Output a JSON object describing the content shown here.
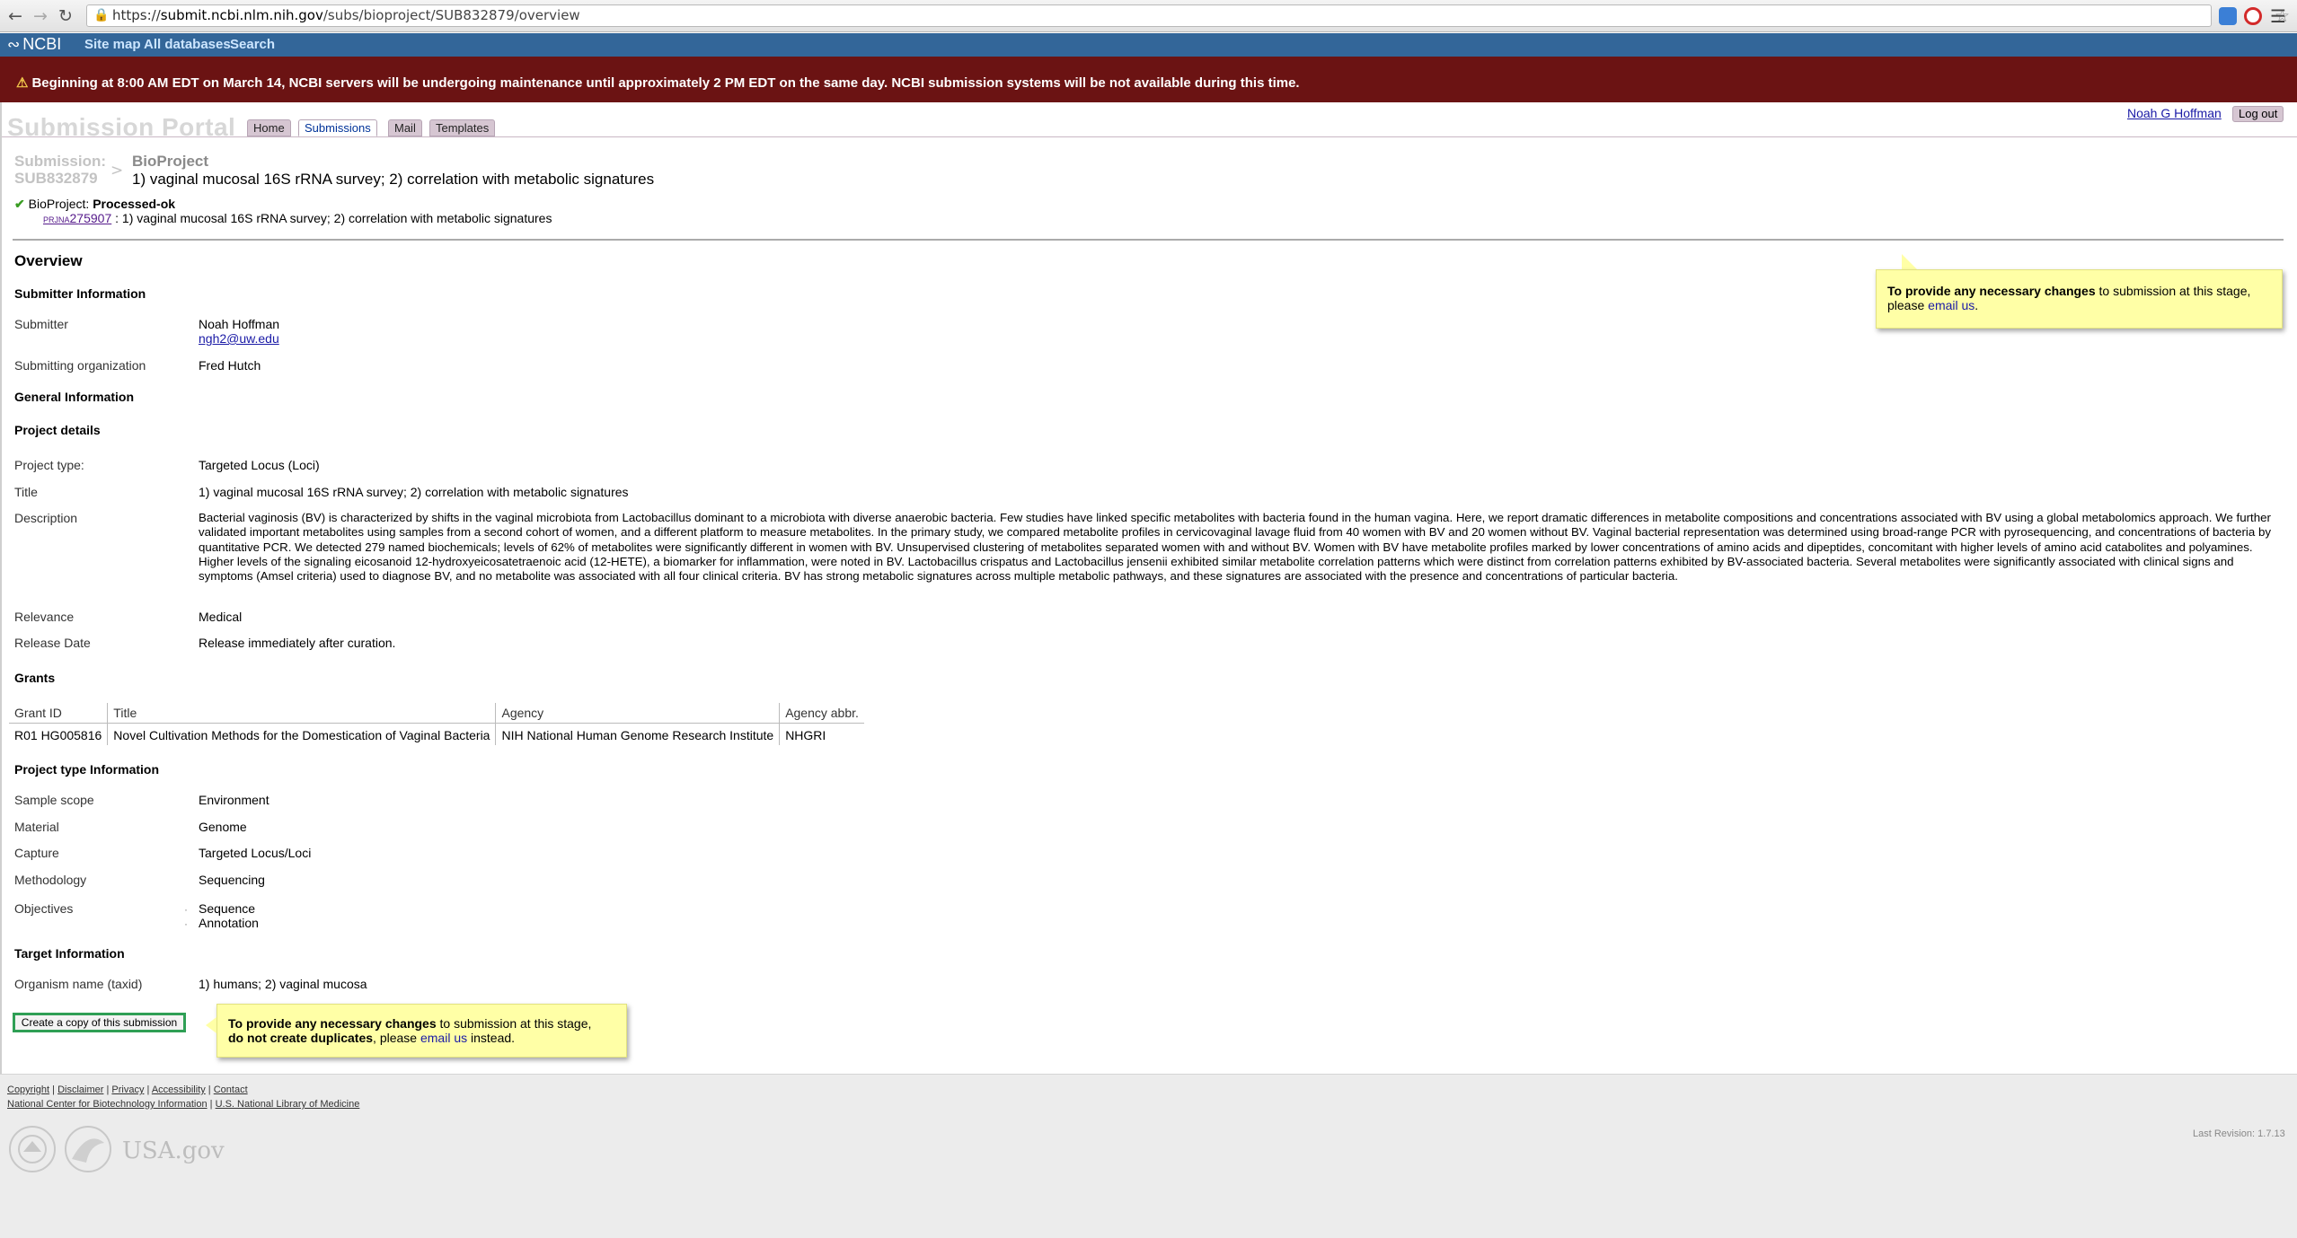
{
  "browser": {
    "url_prefix": "https://",
    "url_host": "submit.ncbi.nlm.nih.gov",
    "url_path": "/subs/bioproject/SUB832879/overview"
  },
  "ncbi": {
    "logo": "NCBI",
    "links": [
      "Site map",
      "All databases",
      "Search"
    ]
  },
  "alert": {
    "text": "Beginning at 8:00 AM EDT on March 14, NCBI servers will be undergoing maintenance until approximately 2 PM EDT on the same day. NCBI submission systems will be not available during this time."
  },
  "portal": {
    "title": "Submission Portal",
    "tabs": [
      "Home",
      "Submissions",
      "Mail",
      "Templates"
    ],
    "user": "Noah G Hoffman",
    "logout": "Log out"
  },
  "submission": {
    "label": "Submission:",
    "id": "SUB832879",
    "type": "BioProject",
    "title": "1) vaginal mucosal 16S rRNA survey; 2) correlation with metabolic signatures",
    "status_label": "BioProject:",
    "status_value": "Processed-ok",
    "accession_prefix": "PRJNA",
    "accession_num": "275907",
    "accession_title": ": 1) vaginal mucosal 16S rRNA survey; 2) correlation with metabolic signatures"
  },
  "overview": {
    "heading": "Overview",
    "submitter_section": "Submitter Information",
    "submitter_label": "Submitter",
    "submitter_name": "Noah Hoffman",
    "submitter_email": "ngh2@uw.edu",
    "org_label": "Submitting organization",
    "org_value": "Fred Hutch",
    "general_section": "General Information",
    "project_details": "Project details",
    "project_type_label": "Project type:",
    "project_type_value": "Targeted Locus (Loci)",
    "title_label": "Title",
    "title_value": "1) vaginal mucosal 16S rRNA survey; 2) correlation with metabolic signatures",
    "description_label": "Description",
    "description_value": "Bacterial vaginosis (BV) is characterized by shifts in the vaginal microbiota from Lactobacillus dominant to a microbiota with diverse anaerobic bacteria. Few studies have linked specific metabolites with bacteria found in the human vagina. Here, we report dramatic differences in metabolite compositions and concentrations associated with BV using a global metabolomics approach. We further validated important metabolites using samples from a second cohort of women, and a different platform to measure metabolites. In the primary study, we compared metabolite profiles in cervicovaginal lavage fluid from 40 women with BV and 20 women without BV. Vaginal bacterial representation was determined using broad-range PCR with pyrosequencing, and concentrations of bacteria by quantitative PCR. We detected 279 named biochemicals; levels of 62% of metabolites were significantly different in women with BV. Unsupervised clustering of metabolites separated women with and without BV. Women with BV have metabolite profiles marked by lower concentrations of amino acids and dipeptides, concomitant with higher levels of amino acid catabolites and polyamines. Higher levels of the signaling eicosanoid 12-hydroxyeicosatetraenoic acid (12-HETE), a biomarker for inflammation, were noted in BV. Lactobacillus crispatus and Lactobacillus jensenii exhibited similar metabolite correlation patterns which were distinct from correlation patterns exhibited by BV-associated bacteria. Several metabolites were significantly associated with clinical signs and symptoms (Amsel criteria) used to diagnose BV, and no metabolite was associated with all four clinical criteria. BV has strong metabolic signatures across multiple metabolic pathways, and these signatures are associated with the presence and concentrations of particular bacteria.",
    "relevance_label": "Relevance",
    "relevance_value": "Medical",
    "release_label": "Release Date",
    "release_value": "Release immediately after curation.",
    "grants_section": "Grants",
    "grants_headers": [
      "Grant ID",
      "Title",
      "Agency",
      "Agency abbr."
    ],
    "grants_rows": [
      [
        "R01 HG005816",
        "Novel Cultivation Methods for the Domestication of Vaginal Bacteria",
        "NIH National Human Genome Research Institute",
        "NHGRI"
      ]
    ],
    "ptype_section": "Project type Information",
    "sample_scope_label": "Sample scope",
    "sample_scope_value": "Environment",
    "material_label": "Material",
    "material_value": "Genome",
    "capture_label": "Capture",
    "capture_value": "Targeted Locus/Loci",
    "methodology_label": "Methodology",
    "methodology_value": "Sequencing",
    "objectives_label": "Objectives",
    "objectives": [
      "Sequence",
      "Annotation"
    ],
    "target_section": "Target Information",
    "organism_label": "Organism name (taxid)",
    "organism_value": "1) humans; 2) vaginal mucosa"
  },
  "actions": {
    "copy_button": "Create a copy of this submission"
  },
  "tips": {
    "top_bold": "To provide any necessary changes",
    "top_rest": " to submission at this stage,",
    "top_line2": "please ",
    "top_link": "email us",
    "top_end": ".",
    "bottom_bold": "To provide any necessary changes",
    "bottom_rest": " to submission at this stage,",
    "bottom_bold2": "do not create duplicates",
    "bottom_mid": ", please ",
    "bottom_link": "email us",
    "bottom_end": " instead."
  },
  "footer": {
    "links1": [
      "Copyright",
      "Disclaimer",
      "Privacy",
      "Accessibility",
      "Contact"
    ],
    "links2": [
      "National Center for Biotechnology Information",
      "U.S. National Library of Medicine"
    ],
    "usa": "USA.gov",
    "revision": "Last Revision: 1.7.13"
  }
}
